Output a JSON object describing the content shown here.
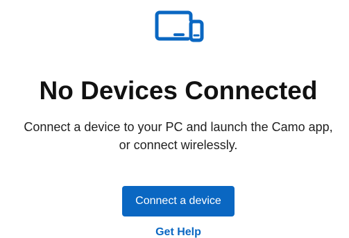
{
  "empty_state": {
    "icon": "devices-icon",
    "title": "No Devices Connected",
    "description_line_1": "Connect a device to your PC and launch the Camo app,",
    "description_line_2": "or connect wirelessly.",
    "primary_button_label": "Connect a device",
    "help_link_label": "Get Help"
  },
  "colors": {
    "accent": "#0a67c2",
    "title": "#111111",
    "text": "#1f1f1f",
    "background": "#ffffff"
  }
}
